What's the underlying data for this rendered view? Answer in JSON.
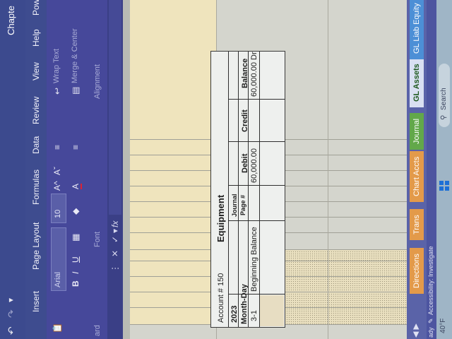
{
  "titlebar": {
    "doc_title": "Chapte"
  },
  "ribbon_tabs": [
    "Insert",
    "Page Layout",
    "Formulas",
    "Data",
    "Review",
    "View",
    "Help",
    "Pow"
  ],
  "ribbon": {
    "font_name": "Arial",
    "font_size": "10",
    "bold": "B",
    "italic": "I",
    "underline": "U",
    "font_group": "Font",
    "alignment_group": "Alignment",
    "wrap_text": "Wrap Text",
    "merge_center": "Merge & Center",
    "clipboard_group": "ard",
    "grow_font": "A^",
    "shrink_font": "Aˇ",
    "font_color": "A"
  },
  "formula_bar": {
    "fx": "fx",
    "cancel": "✕",
    "confirm": "✓"
  },
  "ledger": {
    "account_label": "Account # 150",
    "account_name": "Equipment",
    "year": "2023",
    "month_day": "Month-Day",
    "journal_page": [
      "Journal",
      "Page #"
    ],
    "debit": "Debit",
    "credit": "Credit",
    "balance": "Balance",
    "row": {
      "date": "3-1",
      "description": "Beginning Balance",
      "debit": "60,000.00",
      "balance": "60,000.00",
      "balance_type": "Dr"
    }
  },
  "sheet_tabs": [
    {
      "label": "Directions",
      "color": "#e39a4a"
    },
    {
      "label": "Trans",
      "color": "#e39a4a"
    },
    {
      "label": "Chart Accts",
      "color": "#e39a4a"
    },
    {
      "label": "Journal",
      "color": "#62a84a"
    },
    {
      "label": "GL Assets",
      "color": "#d9e0f2",
      "active": true
    },
    {
      "label": "GL Liab Equity",
      "color": "#4c8fd6"
    }
  ],
  "status": {
    "ready": "ady",
    "accessibility": "Accessibility: Investigate"
  },
  "taskbar": {
    "weather": "40°F",
    "search": "Search"
  }
}
